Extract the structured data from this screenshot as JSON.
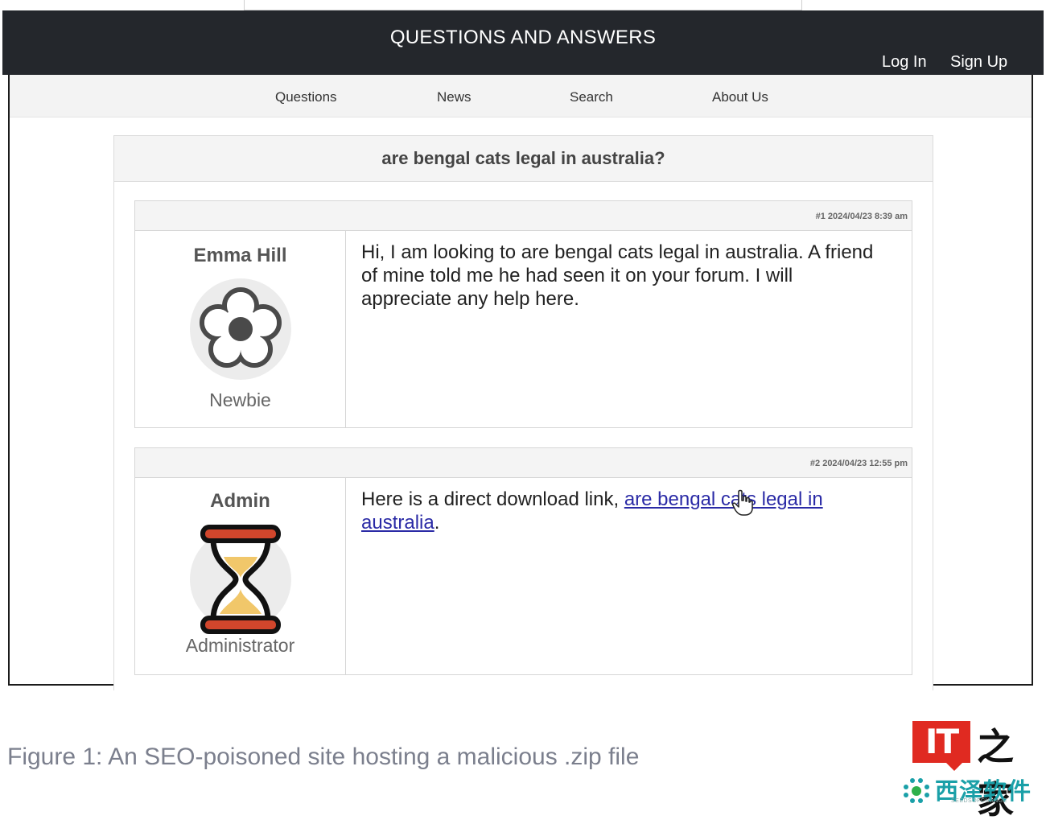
{
  "header": {
    "title": "QUESTIONS AND ANSWERS",
    "login_label": "Log In",
    "signup_label": "Sign Up"
  },
  "nav": {
    "items": [
      {
        "label": "Questions"
      },
      {
        "label": "News"
      },
      {
        "label": "Search"
      },
      {
        "label": "About Us"
      }
    ]
  },
  "thread": {
    "title": "are bengal cats legal in australia?",
    "posts": [
      {
        "meta": "#1 2024/04/23 8:39 am",
        "author": "Emma Hill",
        "role": "Newbie",
        "avatar_icon": "flower-icon",
        "text": "Hi, I am looking to are bengal cats legal in australia. A friend of mine told me he had seen it on your forum. I will appreciate any help here."
      },
      {
        "meta": "#2 2024/04/23 12:55 pm",
        "author": "Admin",
        "role": "Administrator",
        "avatar_icon": "hourglass-icon",
        "text_before": "Here is a direct download link, ",
        "link_text": "are bengal cats legal in australia",
        "text_after": "."
      }
    ]
  },
  "caption": "Figure 1: An SEO-poisoned site hosting a malicious .zip file",
  "logo": {
    "it_text": "IT",
    "home_text": "之家",
    "company_text": "西泽软件",
    "sub_text": "SEEDSOFCHANGE"
  },
  "colors": {
    "header_bg": "#24272c",
    "link": "#2a2aa6",
    "logo_red": "#e02a21",
    "logo_teal": "#1aa0a8"
  }
}
